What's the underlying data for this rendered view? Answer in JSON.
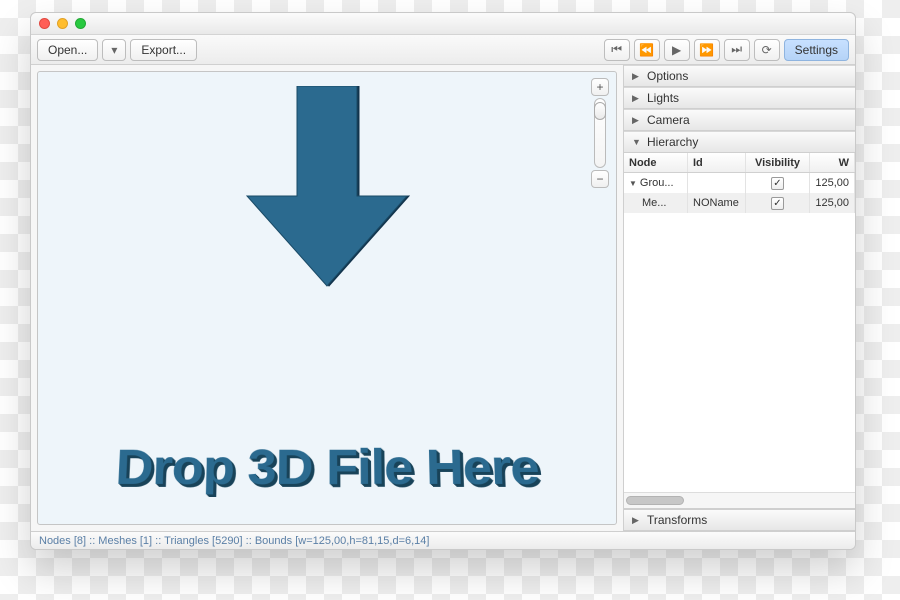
{
  "toolbar": {
    "open_label": "Open...",
    "export_label": "Export...",
    "settings_label": "Settings"
  },
  "viewport": {
    "drop_text": "Drop 3D File Here"
  },
  "panels": {
    "options": "Options",
    "lights": "Lights",
    "camera": "Camera",
    "hierarchy": "Hierarchy",
    "transforms": "Transforms"
  },
  "hierarchy": {
    "columns": {
      "node": "Node",
      "id": "Id",
      "visibility": "Visibility",
      "w": "W"
    },
    "rows": [
      {
        "node": "Grou...",
        "id": "",
        "visible": true,
        "w": "125,00",
        "indent": 0,
        "expanded": true
      },
      {
        "node": "Me...",
        "id": "NOName",
        "visible": true,
        "w": "125,00",
        "indent": 1
      }
    ]
  },
  "status": {
    "text": "Nodes [8] :: Meshes [1] :: Triangles [5290] :: Bounds [w=125,00,h=81,15,d=6,14]"
  }
}
